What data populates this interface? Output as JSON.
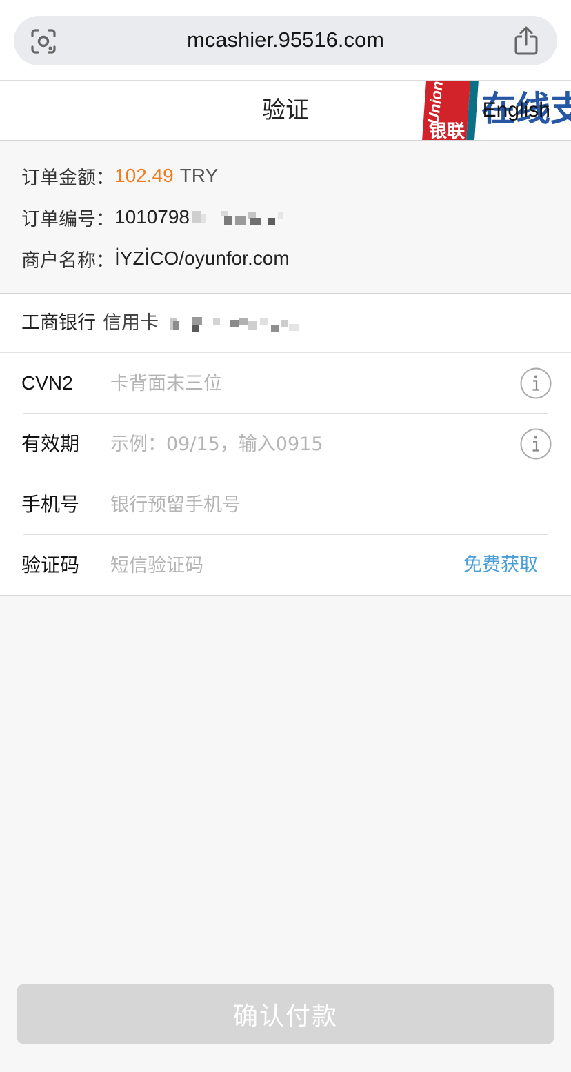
{
  "browser": {
    "url": "mcashier.95516.com",
    "lens_icon": "visual-search-icon",
    "share_icon": "share-icon"
  },
  "header": {
    "title": "验证",
    "language_link": "English",
    "logo_text_latin": "UnionPay",
    "logo_text_cn": "银联",
    "logo_overlay_text": "在线支付"
  },
  "order": {
    "amount_label": "订单金额：",
    "amount_value": "102.49",
    "currency": "TRY",
    "number_label": "订单编号：",
    "number_value": "1010798",
    "merchant_label": "商户名称：",
    "merchant_value": "İYZİCO/oyunfor.com"
  },
  "card": {
    "bank": "工商银行",
    "type": "信用卡"
  },
  "form": {
    "cvn2": {
      "label": "CVN2",
      "placeholder": "卡背面末三位",
      "icon": "info-icon"
    },
    "expiry": {
      "label": "有效期",
      "placeholder": "示例：09/15，输入0915",
      "icon": "info-icon"
    },
    "phone": {
      "label": "手机号",
      "placeholder": "银行预留手机号"
    },
    "sms": {
      "label": "验证码",
      "placeholder": "短信验证码",
      "action": "免费获取"
    }
  },
  "confirm_button": "确认付款",
  "colors": {
    "amount": "#f07c1e",
    "link": "#4a9fd8",
    "button_disabled": "#d6d6d6",
    "background": "#f7f7f7"
  }
}
